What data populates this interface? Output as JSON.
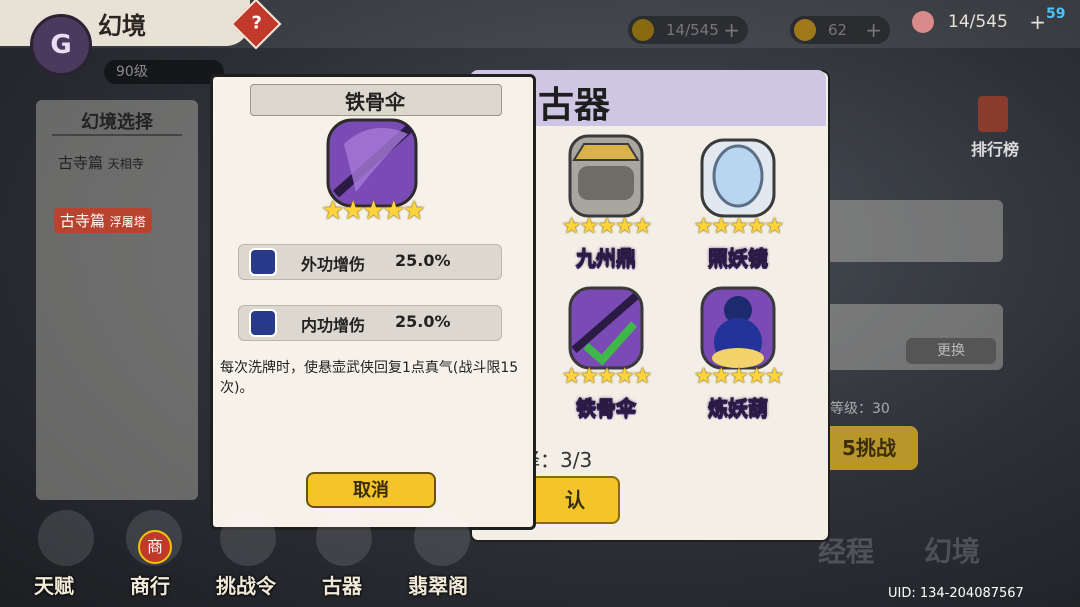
{
  "header": {
    "title": "幻境",
    "help_glyph": "?",
    "level": "90级",
    "resource1": "14/545",
    "resource2": "62",
    "top_resource": "14/545",
    "top_badge": "59"
  },
  "left_panel": {
    "title": "幻境选择",
    "items": [
      {
        "main": "古寺篇",
        "sub": "天相寺"
      },
      {
        "main": "古寺篇",
        "sub": "浮屠塔"
      }
    ]
  },
  "right_side": {
    "rank_label": "排行榜",
    "swap_label": "更换",
    "rec_level": "等级：30",
    "challenge_label": "5挑战"
  },
  "relics": {
    "title": "古器",
    "items": [
      {
        "name": "九州鼎",
        "stars": "★★★★★"
      },
      {
        "name": "照妖镜",
        "stars": "★★★★★"
      },
      {
        "name": "铁骨伞",
        "stars": "★★★★★"
      },
      {
        "name": "炼妖葫",
        "stars": "★★★★★"
      }
    ],
    "count": "择：3/3",
    "confirm_label": "认"
  },
  "dialog": {
    "title": "铁骨伞",
    "stars": "★★★★★",
    "stats": [
      {
        "label": "外功增伤",
        "value": "25.0%"
      },
      {
        "label": "内功增伤",
        "value": "25.0%"
      }
    ],
    "description": "每次洗牌时，使悬壶武侠回复1点真气(战斗限15次)。",
    "cancel_label": "取消"
  },
  "bottom_nav": [
    {
      "label": "天赋"
    },
    {
      "label": "商行"
    },
    {
      "label": "挑战令"
    },
    {
      "label": "古器"
    },
    {
      "label": "翡翠阁"
    }
  ],
  "shop_badge": "商",
  "deco_left": "经程",
  "deco_right": "幻境",
  "uid": "UID: 134-204087567"
}
